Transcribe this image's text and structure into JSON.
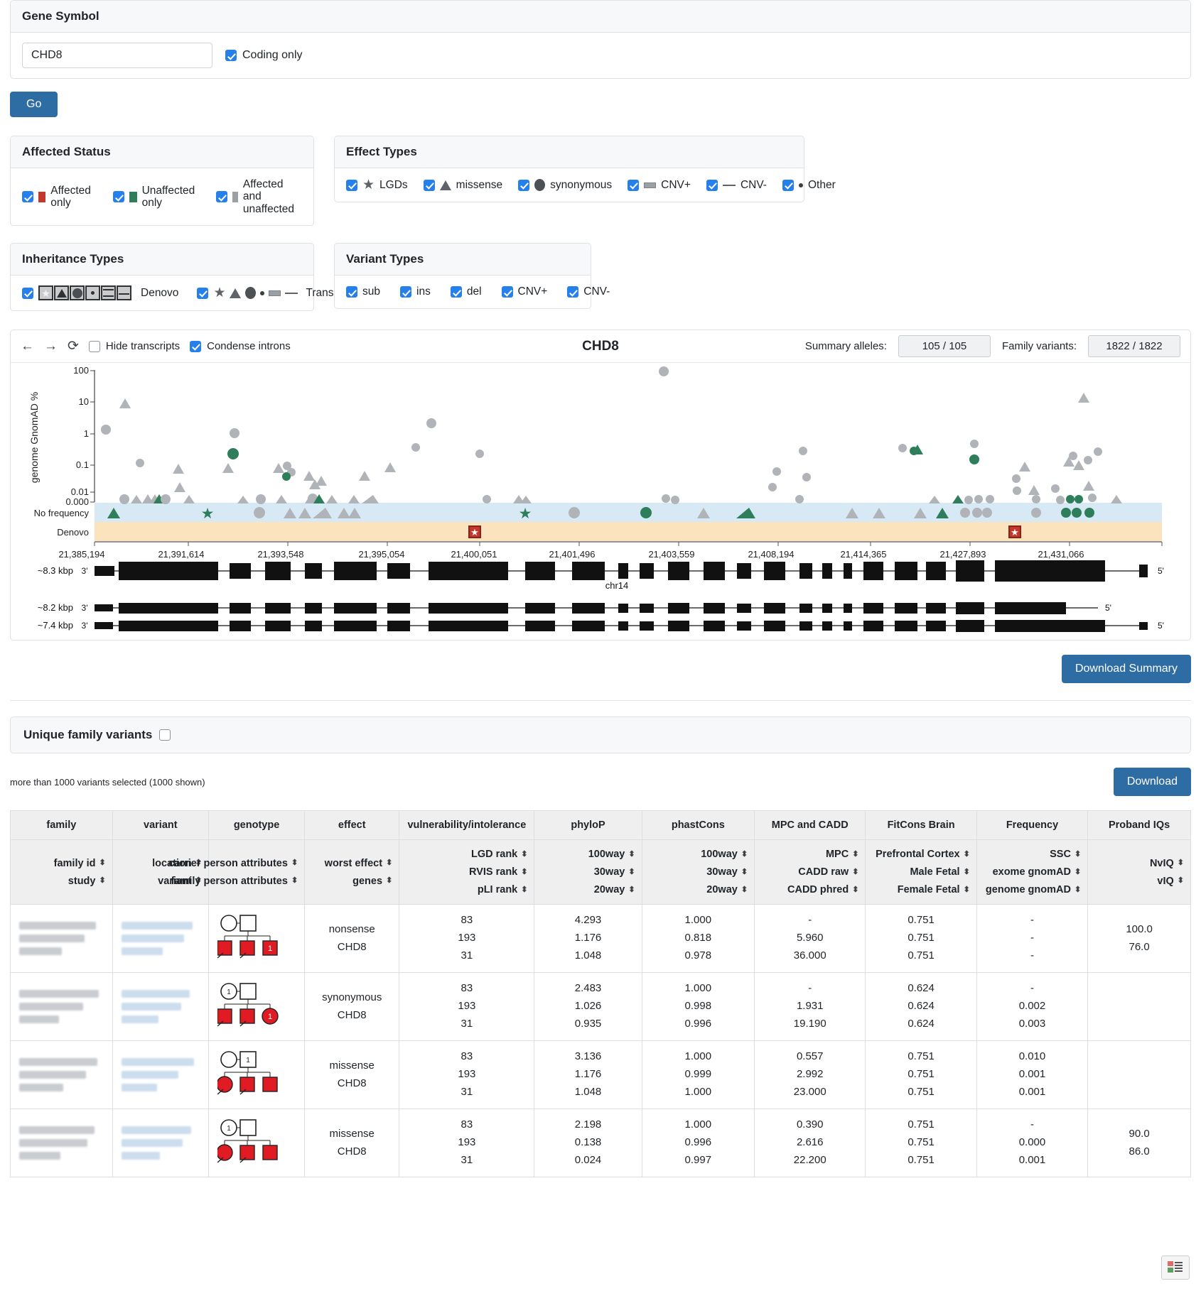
{
  "gene_panel": {
    "title": "Gene Symbol",
    "gene_value": "CHD8",
    "gene_placeholder": "",
    "coding_only_label": "Coding only",
    "go_label": "Go"
  },
  "affected_status": {
    "title": "Affected Status",
    "options": [
      {
        "label": "Affected only",
        "color": "#c0392b",
        "swatch": "red"
      },
      {
        "label": "Unaffected only",
        "color": "#2e7d5b",
        "swatch": "green"
      },
      {
        "label": "Affected and unaffected",
        "color": "#9aa0a6",
        "swatch": "grey"
      }
    ]
  },
  "effect_types": {
    "title": "Effect Types",
    "options": [
      {
        "label": "LGDs",
        "icon": "star-icon"
      },
      {
        "label": "missense",
        "icon": "triangle-icon"
      },
      {
        "label": "synonymous",
        "icon": "circle-icon"
      },
      {
        "label": "CNV+",
        "icon": "cnv-plus-icon"
      },
      {
        "label": "CNV-",
        "icon": "cnv-minus-icon"
      },
      {
        "label": "Other",
        "icon": "small-dot-icon"
      }
    ]
  },
  "inheritance_types": {
    "title": "Inheritance Types",
    "options": [
      {
        "label": "Denovo",
        "icon": "denovo-glyph-strip"
      },
      {
        "label": "Transmitted",
        "icon": "transmitted-glyph-strip"
      }
    ]
  },
  "variant_types": {
    "title": "Variant Types",
    "options": [
      {
        "label": "sub"
      },
      {
        "label": "ins"
      },
      {
        "label": "del"
      },
      {
        "label": "CNV+"
      },
      {
        "label": "CNV-"
      }
    ]
  },
  "browser": {
    "back_icon": "arrow-left-icon",
    "forward_icon": "arrow-right-icon",
    "reset_icon": "refresh-icon",
    "hide_transcripts_label": "Hide transcripts",
    "hide_transcripts_checked": false,
    "condense_introns_label": "Condense introns",
    "condense_introns_checked": true,
    "title": "CHD8",
    "summary_alleles_label": "Summary alleles:",
    "summary_alleles_value": "105 / 105",
    "family_variants_label": "Family variants:",
    "family_variants_value": "1822 / 1822",
    "chromosome": "chr14",
    "transcripts": [
      {
        "length": "~8.3 kbp",
        "left_end": "3'",
        "right_end": "5'"
      },
      {
        "length": "~8.2 kbp",
        "left_end": "3'",
        "right_end": "5'"
      },
      {
        "length": "~7.4 kbp",
        "left_end": "3'",
        "right_end": "5'"
      }
    ]
  },
  "chart_data": {
    "type": "scatter",
    "title": "CHD8",
    "ylabel": "genome GnomAD %",
    "xlabel": "chr14",
    "ytick_labels": [
      "100",
      "10",
      "1",
      "0.1",
      "0.01",
      "0.000"
    ],
    "yscale": "log",
    "band_labels": [
      "No frequency",
      "Denovo"
    ],
    "band_colors": [
      "#d7e9f4",
      "#fbe3bd"
    ],
    "xtick_labels": [
      "21,385,194",
      "21,391,614",
      "21,393,548",
      "21,395,054",
      "21,400,051",
      "21,401,496",
      "21,403,559",
      "21,408,194",
      "21,414,365",
      "21,427,893",
      "21,431,066"
    ],
    "series": [
      {
        "name": "missense (triangle)",
        "marker": "triangle",
        "color": "#b0b4b8"
      },
      {
        "name": "synonymous (circle)",
        "marker": "circle",
        "color": "#b0b4b8"
      },
      {
        "name": "unaffected only (green)",
        "marker": "triangle",
        "color": "#2e7d5b"
      },
      {
        "name": "LGDs (star)",
        "marker": "star",
        "color": "#2e7d5b"
      },
      {
        "name": "denovo LGD",
        "marker": "denovo-box",
        "color": "#c0392b"
      }
    ],
    "points": [
      {
        "x": 21385400,
        "y": 1.6,
        "marker": "circle",
        "color": "#b0b4b8"
      },
      {
        "x": 21385900,
        "y": 0.05,
        "marker": "circle",
        "color": "#b0b4b8"
      },
      {
        "x": 21386100,
        "y": 6.0,
        "marker": "triangle",
        "color": "#b0b4b8"
      },
      {
        "x": 21386400,
        "y": 0.02,
        "marker": "triangle",
        "color": "#b0b4b8"
      },
      {
        "x": 21386900,
        "y": 0.09,
        "marker": "circle",
        "color": "#b0b4b8"
      },
      {
        "x": 21387900,
        "y": 0.09,
        "marker": "triangle",
        "color": "#b0b4b8"
      },
      {
        "x": 21389600,
        "y": 0.3,
        "marker": "circle",
        "color": "#2e7d5b"
      },
      {
        "x": 21389900,
        "y": 1.4,
        "marker": "circle",
        "color": "#b0b4b8"
      },
      {
        "x": 21390700,
        "y": 0.1,
        "marker": "triangle",
        "color": "#b0b4b8"
      },
      {
        "x": 21392600,
        "y": 0.08,
        "marker": "circle",
        "color": "#b0b4b8"
      },
      {
        "x": 21392700,
        "y": 0.04,
        "marker": "circle",
        "color": "#2e7d5b"
      },
      {
        "x": 21393400,
        "y": 2.6,
        "marker": "circle",
        "color": "#b0b4b8"
      },
      {
        "x": 21394000,
        "y": 0.5,
        "marker": "circle",
        "color": "#b0b4b8"
      },
      {
        "x": 21395100,
        "y": 0.5,
        "marker": "circle",
        "color": "#b0b4b8"
      },
      {
        "x": 21403559,
        "y": 100.0,
        "marker": "circle",
        "color": "#b0b4b8"
      },
      {
        "x": 21408000,
        "y": 0.7,
        "marker": "circle",
        "color": "#b0b4b8"
      },
      {
        "x": 21414000,
        "y": 0.8,
        "marker": "triangle",
        "color": "#2e7d5b"
      },
      {
        "x": 21427893,
        "y": 1.0,
        "marker": "circle",
        "color": "#b0b4b8"
      },
      {
        "x": 21428600,
        "y": 0.06,
        "marker": "circle",
        "color": "#2e7d5b"
      },
      {
        "x": 21431066,
        "y": 18.0,
        "marker": "triangle",
        "color": "#b0b4b8"
      }
    ]
  },
  "download_summary_label": "Download Summary",
  "unique_family_variants": {
    "label": "Unique family variants",
    "checked": false
  },
  "results": {
    "note": "more than 1000 variants selected (1000 shown)",
    "download_label": "Download"
  },
  "table": {
    "group_headers": [
      "family",
      "variant",
      "genotype",
      "effect",
      "vulnerability/intolerance",
      "phyloP",
      "phastCons",
      "MPC and CADD",
      "FitCons Brain",
      "Frequency",
      "Proband IQs"
    ],
    "sub_headers": [
      [
        "family id",
        "study"
      ],
      [
        "location",
        "variant"
      ],
      [
        "carrier person attributes",
        "family person attributes"
      ],
      [
        "worst effect",
        "genes"
      ],
      [
        "LGD rank",
        "RVIS rank",
        "pLI rank"
      ],
      [
        "100way",
        "30way",
        "20way"
      ],
      [
        "100way",
        "30way",
        "20way"
      ],
      [
        "MPC",
        "CADD raw",
        "CADD phred"
      ],
      [
        "Prefrontal Cortex",
        "Male Fetal",
        "Female Fetal"
      ],
      [
        "SSC",
        "exome gnomAD",
        "genome gnomAD"
      ],
      [
        "NvIQ",
        "vIQ"
      ]
    ],
    "rows": [
      {
        "effect": [
          "nonsense",
          "CHD8"
        ],
        "vulnerability": [
          "83",
          "193",
          "31"
        ],
        "phylop": [
          "4.293",
          "1.176",
          "1.048"
        ],
        "phastcons": [
          "1.000",
          "0.818",
          "0.978"
        ],
        "mpc_cadd": [
          "-",
          "5.960",
          "36.000"
        ],
        "fitcons": [
          "0.751",
          "0.751",
          "0.751"
        ],
        "frequency": [
          "-",
          "-",
          "-"
        ],
        "iqs": [
          "100.0",
          "76.0"
        ]
      },
      {
        "effect": [
          "synonymous",
          "CHD8"
        ],
        "vulnerability": [
          "83",
          "193",
          "31"
        ],
        "phylop": [
          "2.483",
          "1.026",
          "0.935"
        ],
        "phastcons": [
          "1.000",
          "0.998",
          "0.996"
        ],
        "mpc_cadd": [
          "-",
          "1.931",
          "19.190"
        ],
        "fitcons": [
          "0.624",
          "0.624",
          "0.624"
        ],
        "frequency": [
          "-",
          "0.002",
          "0.003"
        ],
        "iqs": [
          "",
          ""
        ]
      },
      {
        "effect": [
          "missense",
          "CHD8"
        ],
        "vulnerability": [
          "83",
          "193",
          "31"
        ],
        "phylop": [
          "3.136",
          "1.176",
          "1.048"
        ],
        "phastcons": [
          "1.000",
          "0.999",
          "1.000"
        ],
        "mpc_cadd": [
          "0.557",
          "2.992",
          "23.000"
        ],
        "fitcons": [
          "0.751",
          "0.751",
          "0.751"
        ],
        "frequency": [
          "0.010",
          "0.001",
          "0.001"
        ],
        "iqs": [
          "",
          ""
        ]
      },
      {
        "effect": [
          "missense",
          "CHD8"
        ],
        "vulnerability": [
          "83",
          "193",
          "31"
        ],
        "phylop": [
          "2.198",
          "0.138",
          "0.024"
        ],
        "phastcons": [
          "1.000",
          "0.996",
          "0.997"
        ],
        "mpc_cadd": [
          "0.390",
          "2.616",
          "22.200"
        ],
        "fitcons": [
          "0.751",
          "0.751",
          "0.751"
        ],
        "frequency": [
          "-",
          "0.000",
          "0.001"
        ],
        "iqs": [
          "90.0",
          "86.0"
        ]
      }
    ]
  }
}
